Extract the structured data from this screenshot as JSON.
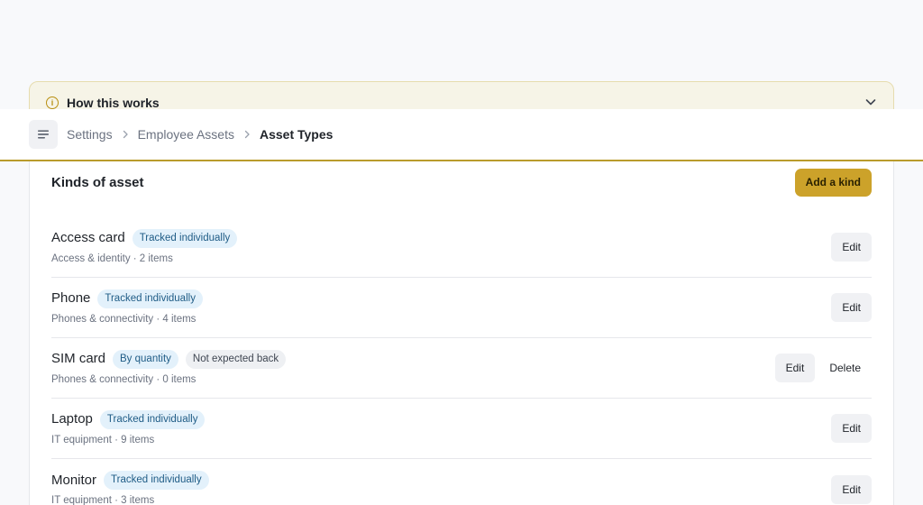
{
  "banner": {
    "icon": "info-icon",
    "title": "How this works"
  },
  "breadcrumb": {
    "items": [
      "Settings",
      "Employee Assets",
      "Asset Types"
    ]
  },
  "card": {
    "title": "Kinds of asset",
    "add_label": "Add a kind"
  },
  "rows": [
    {
      "name": "Access card",
      "tags": [
        "Tracked individually"
      ],
      "meta": "Access & identity · 2 items",
      "edit": "Edit"
    },
    {
      "name": "Phone",
      "tags": [
        "Tracked individually"
      ],
      "meta": "Phones & connectivity · 4 items",
      "edit": "Edit"
    },
    {
      "name": "SIM card",
      "tags": [
        "By quantity",
        "Not expected back"
      ],
      "meta": "Phones & connectivity · 0 items",
      "edit": "Edit",
      "delete": "Delete"
    },
    {
      "name": "Laptop",
      "tags": [
        "Tracked individually"
      ],
      "meta": "IT equipment · 9 items",
      "edit": "Edit"
    },
    {
      "name": "Monitor",
      "tags": [
        "Tracked individually"
      ],
      "meta": "IT equipment · 3 items",
      "edit": "Edit"
    }
  ],
  "colors": {
    "accent": "#cca22a",
    "header_border": "#b99b2c",
    "tag_blue_bg": "#e3f1fb",
    "tag_blue_text": "#1f5c86",
    "tag_gray_bg": "#eef0f3"
  }
}
